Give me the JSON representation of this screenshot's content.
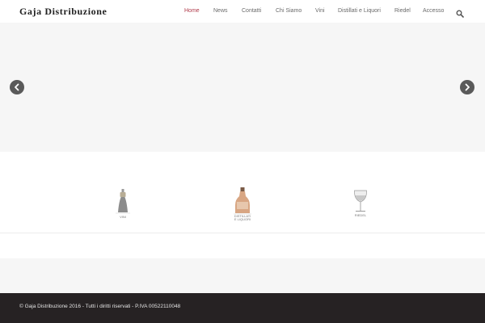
{
  "header": {
    "logo": "Gaja Distribuzione",
    "nav": [
      {
        "label": "Home",
        "active": true
      },
      {
        "label": "News",
        "active": false
      },
      {
        "label": "Contatti",
        "active": false
      },
      {
        "label": "Chi Siamo",
        "active": false
      },
      {
        "label": "Vini",
        "active": false
      },
      {
        "label": "Distillati e Liquori",
        "active": false
      },
      {
        "label": "Riedel",
        "active": false
      },
      {
        "label": "Accesso",
        "active": false
      }
    ],
    "search_icon": "search-icon"
  },
  "slider": {
    "prev_icon": "chevron-left-icon",
    "next_icon": "chevron-right-icon"
  },
  "categories": [
    {
      "label": "VINI",
      "icon": "wine-bottle-icon"
    },
    {
      "label": "DISTILLATI\nE LIQUORI",
      "icon": "liquor-bottle-icon"
    },
    {
      "label": "RIEDEL",
      "icon": "wine-glass-icon"
    }
  ],
  "footer": {
    "text": "© Gaja Distribuzione 2016 - Tutti i diritti riservati - P.IVA 00522110048"
  },
  "colors": {
    "accent": "#b03a4a",
    "nav_text": "#6a6a6a",
    "slider_bg": "#f6f6f6",
    "footer_bg": "#262223",
    "arrow_bg": "#5a5a5a"
  }
}
